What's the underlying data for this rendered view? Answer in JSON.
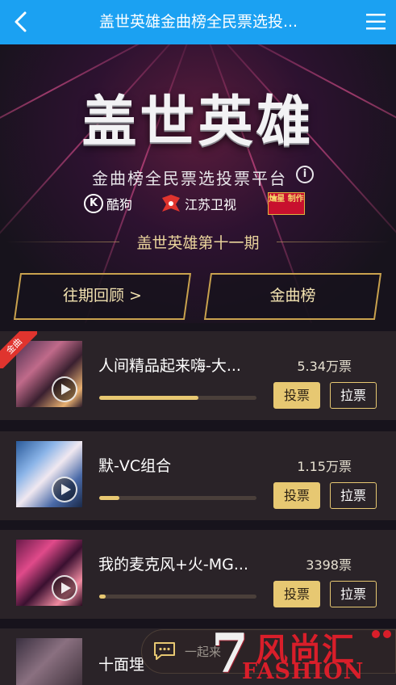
{
  "navbar": {
    "title": "盖世英雄金曲榜全民票选投...",
    "back_icon": "back-arrow-icon",
    "menu_icon": "hamburger-menu-icon",
    "bg_color": "#1ba1f2"
  },
  "banner": {
    "title": "盖世英雄",
    "subtitle": "金曲榜全民票选投票平台",
    "info_glyph": "i",
    "logos": {
      "kugou": {
        "mark": "K",
        "label": "酷狗"
      },
      "jstv": {
        "label": "江苏卫视"
      },
      "canxing": {
        "label": "灿星 制作"
      }
    },
    "episode": "盖世英雄第十一期"
  },
  "tabs": [
    {
      "label": "往期回顾 >"
    },
    {
      "label": "金曲榜"
    }
  ],
  "songs": [
    {
      "badge": "金曲",
      "title": "人间精品起来嗨-大...",
      "votes": "5.34万票",
      "progress": 0.63,
      "vote_label": "投票",
      "pull_label": "拉票"
    },
    {
      "title": "默-VC组合",
      "votes": "1.15万票",
      "progress": 0.13,
      "vote_label": "投票",
      "pull_label": "拉票"
    },
    {
      "title": "我的麦克风+火-MG...",
      "votes": "3398票",
      "progress": 0.04,
      "vote_label": "投票",
      "pull_label": "拉票"
    },
    {
      "title": "十面埋",
      "votes": "",
      "progress": 0,
      "vote_label": "",
      "pull_label": ""
    }
  ],
  "chat": {
    "placeholder": "一起来",
    "icon": "chat-bubble-icon"
  },
  "watermark": {
    "digit": "7",
    "cn": "风尚汇",
    "en": "FASHION"
  },
  "colors": {
    "accent_gold": "#e7c872",
    "badge_red": "#e0342e",
    "page_bg": "#17131c",
    "card_bg": "#2a2328"
  }
}
